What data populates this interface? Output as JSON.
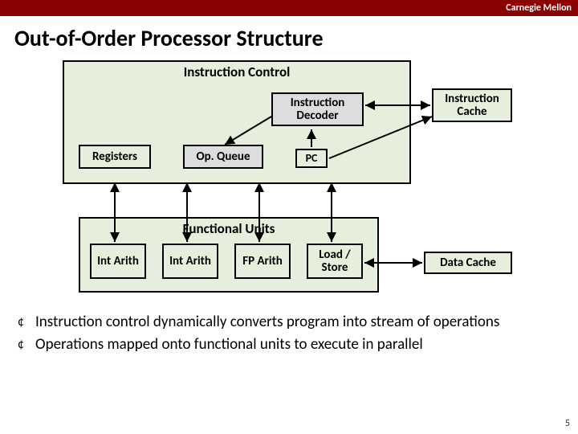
{
  "brand": "Carnegie Mellon",
  "title": "Out-of-Order Processor Structure",
  "instruction_control": {
    "label": "Instruction Control",
    "registers": "Registers",
    "op_queue": "Op. Queue",
    "decoder": "Instruction Decoder",
    "pc": "PC"
  },
  "instruction_cache": "Instruction Cache",
  "functional_units": {
    "label": "Functional Units",
    "units": [
      "Int Arith",
      "Int Arith",
      "FP Arith",
      "Load / Store"
    ]
  },
  "data_cache": "Data Cache",
  "bullets": [
    "Instruction control dynamically converts program into stream of operations",
    "Operations mapped onto functional units to execute in parallel"
  ],
  "page_number": "5"
}
